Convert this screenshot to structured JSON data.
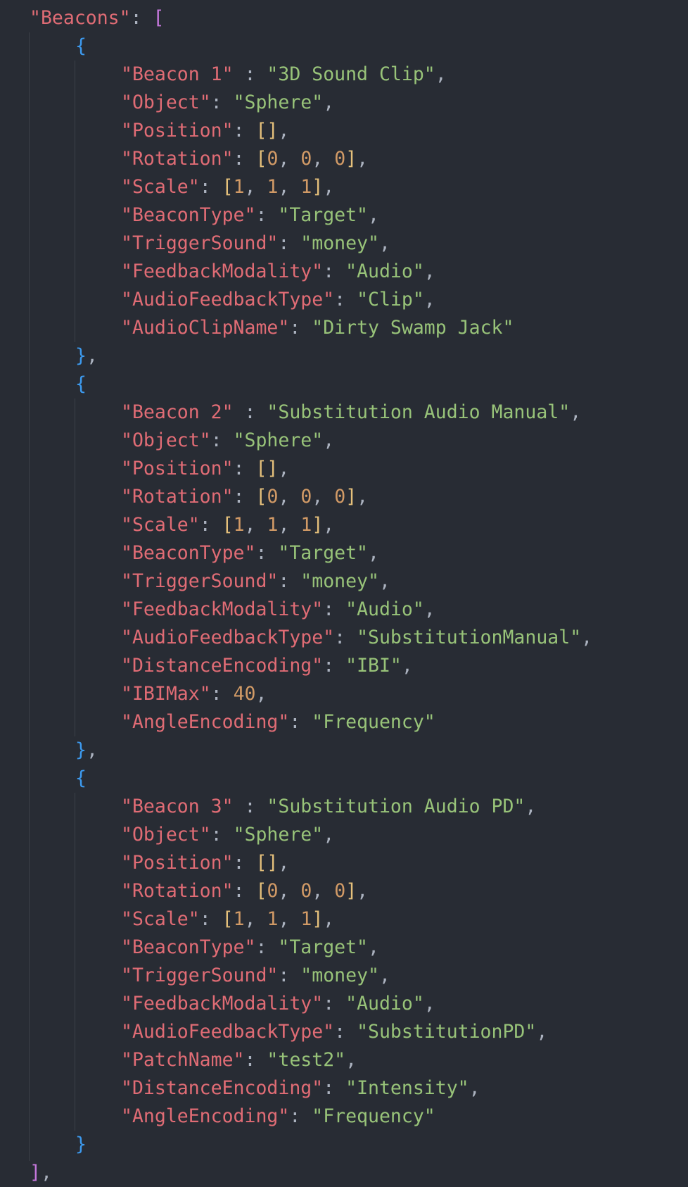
{
  "colors": {
    "background": "#282c34",
    "key": "#e06c75",
    "string": "#98c379",
    "number": "#d19a66",
    "punctuation": "#abb2bf",
    "bracket_level1": "#c678dd",
    "bracket_level2": "#3d9bf0",
    "bracket_level3": "#e5c07b"
  },
  "lines": [
    {
      "indent": 1,
      "tokens": [
        [
          "k",
          "\"Beacons\""
        ],
        [
          "p",
          ": "
        ],
        [
          "b1",
          "["
        ]
      ]
    },
    {
      "indent": 2,
      "tokens": [
        [
          "b2",
          "{"
        ]
      ]
    },
    {
      "indent": 3,
      "tokens": [
        [
          "k",
          "\"Beacon 1\""
        ],
        [
          "p",
          " : "
        ],
        [
          "s",
          "\"3D Sound Clip\""
        ],
        [
          "p",
          ","
        ]
      ]
    },
    {
      "indent": 3,
      "tokens": [
        [
          "k",
          "\"Object\""
        ],
        [
          "p",
          ": "
        ],
        [
          "s",
          "\"Sphere\""
        ],
        [
          "p",
          ","
        ]
      ]
    },
    {
      "indent": 3,
      "tokens": [
        [
          "k",
          "\"Position\""
        ],
        [
          "p",
          ": "
        ],
        [
          "b3",
          "[]"
        ],
        [
          "p",
          ","
        ]
      ]
    },
    {
      "indent": 3,
      "tokens": [
        [
          "k",
          "\"Rotation\""
        ],
        [
          "p",
          ": "
        ],
        [
          "b3",
          "["
        ],
        [
          "n",
          "0"
        ],
        [
          "p",
          ", "
        ],
        [
          "n",
          "0"
        ],
        [
          "p",
          ", "
        ],
        [
          "n",
          "0"
        ],
        [
          "b3",
          "]"
        ],
        [
          "p",
          ","
        ]
      ]
    },
    {
      "indent": 3,
      "tokens": [
        [
          "k",
          "\"Scale\""
        ],
        [
          "p",
          ": "
        ],
        [
          "b3",
          "["
        ],
        [
          "n",
          "1"
        ],
        [
          "p",
          ", "
        ],
        [
          "n",
          "1"
        ],
        [
          "p",
          ", "
        ],
        [
          "n",
          "1"
        ],
        [
          "b3",
          "]"
        ],
        [
          "p",
          ","
        ]
      ]
    },
    {
      "indent": 3,
      "tokens": [
        [
          "k",
          "\"BeaconType\""
        ],
        [
          "p",
          ": "
        ],
        [
          "s",
          "\"Target\""
        ],
        [
          "p",
          ","
        ]
      ]
    },
    {
      "indent": 3,
      "tokens": [
        [
          "k",
          "\"TriggerSound\""
        ],
        [
          "p",
          ": "
        ],
        [
          "s",
          "\"money\""
        ],
        [
          "p",
          ","
        ]
      ]
    },
    {
      "indent": 3,
      "tokens": [
        [
          "k",
          "\"FeedbackModality\""
        ],
        [
          "p",
          ": "
        ],
        [
          "s",
          "\"Audio\""
        ],
        [
          "p",
          ","
        ]
      ]
    },
    {
      "indent": 3,
      "tokens": [
        [
          "k",
          "\"AudioFeedbackType\""
        ],
        [
          "p",
          ": "
        ],
        [
          "s",
          "\"Clip\""
        ],
        [
          "p",
          ","
        ]
      ]
    },
    {
      "indent": 3,
      "tokens": [
        [
          "k",
          "\"AudioClipName\""
        ],
        [
          "p",
          ": "
        ],
        [
          "s",
          "\"Dirty Swamp Jack\""
        ]
      ]
    },
    {
      "indent": 2,
      "tokens": [
        [
          "b2",
          "}"
        ],
        [
          "p",
          ","
        ]
      ]
    },
    {
      "indent": 2,
      "tokens": [
        [
          "b2",
          "{"
        ]
      ]
    },
    {
      "indent": 3,
      "tokens": [
        [
          "k",
          "\"Beacon 2\""
        ],
        [
          "p",
          " : "
        ],
        [
          "s",
          "\"Substitution Audio Manual\""
        ],
        [
          "p",
          ","
        ]
      ]
    },
    {
      "indent": 3,
      "tokens": [
        [
          "k",
          "\"Object\""
        ],
        [
          "p",
          ": "
        ],
        [
          "s",
          "\"Sphere\""
        ],
        [
          "p",
          ","
        ]
      ]
    },
    {
      "indent": 3,
      "tokens": [
        [
          "k",
          "\"Position\""
        ],
        [
          "p",
          ": "
        ],
        [
          "b3",
          "[]"
        ],
        [
          "p",
          ","
        ]
      ]
    },
    {
      "indent": 3,
      "tokens": [
        [
          "k",
          "\"Rotation\""
        ],
        [
          "p",
          ": "
        ],
        [
          "b3",
          "["
        ],
        [
          "n",
          "0"
        ],
        [
          "p",
          ", "
        ],
        [
          "n",
          "0"
        ],
        [
          "p",
          ", "
        ],
        [
          "n",
          "0"
        ],
        [
          "b3",
          "]"
        ],
        [
          "p",
          ","
        ]
      ]
    },
    {
      "indent": 3,
      "tokens": [
        [
          "k",
          "\"Scale\""
        ],
        [
          "p",
          ": "
        ],
        [
          "b3",
          "["
        ],
        [
          "n",
          "1"
        ],
        [
          "p",
          ", "
        ],
        [
          "n",
          "1"
        ],
        [
          "p",
          ", "
        ],
        [
          "n",
          "1"
        ],
        [
          "b3",
          "]"
        ],
        [
          "p",
          ","
        ]
      ]
    },
    {
      "indent": 3,
      "tokens": [
        [
          "k",
          "\"BeaconType\""
        ],
        [
          "p",
          ": "
        ],
        [
          "s",
          "\"Target\""
        ],
        [
          "p",
          ","
        ]
      ]
    },
    {
      "indent": 3,
      "tokens": [
        [
          "k",
          "\"TriggerSound\""
        ],
        [
          "p",
          ": "
        ],
        [
          "s",
          "\"money\""
        ],
        [
          "p",
          ","
        ]
      ]
    },
    {
      "indent": 3,
      "tokens": [
        [
          "k",
          "\"FeedbackModality\""
        ],
        [
          "p",
          ": "
        ],
        [
          "s",
          "\"Audio\""
        ],
        [
          "p",
          ","
        ]
      ]
    },
    {
      "indent": 3,
      "tokens": [
        [
          "k",
          "\"AudioFeedbackType\""
        ],
        [
          "p",
          ": "
        ],
        [
          "s",
          "\"SubstitutionManual\""
        ],
        [
          "p",
          ","
        ]
      ]
    },
    {
      "indent": 3,
      "tokens": [
        [
          "k",
          "\"DistanceEncoding\""
        ],
        [
          "p",
          ": "
        ],
        [
          "s",
          "\"IBI\""
        ],
        [
          "p",
          ","
        ]
      ]
    },
    {
      "indent": 3,
      "tokens": [
        [
          "k",
          "\"IBIMax\""
        ],
        [
          "p",
          ": "
        ],
        [
          "n",
          "40"
        ],
        [
          "p",
          ","
        ]
      ]
    },
    {
      "indent": 3,
      "tokens": [
        [
          "k",
          "\"AngleEncoding\""
        ],
        [
          "p",
          ": "
        ],
        [
          "s",
          "\"Frequency\""
        ]
      ]
    },
    {
      "indent": 2,
      "tokens": [
        [
          "b2",
          "}"
        ],
        [
          "p",
          ","
        ]
      ]
    },
    {
      "indent": 2,
      "tokens": [
        [
          "b2",
          "{"
        ]
      ]
    },
    {
      "indent": 3,
      "tokens": [
        [
          "k",
          "\"Beacon 3\""
        ],
        [
          "p",
          " : "
        ],
        [
          "s",
          "\"Substitution Audio PD\""
        ],
        [
          "p",
          ","
        ]
      ]
    },
    {
      "indent": 3,
      "tokens": [
        [
          "k",
          "\"Object\""
        ],
        [
          "p",
          ": "
        ],
        [
          "s",
          "\"Sphere\""
        ],
        [
          "p",
          ","
        ]
      ]
    },
    {
      "indent": 3,
      "tokens": [
        [
          "k",
          "\"Position\""
        ],
        [
          "p",
          ": "
        ],
        [
          "b3",
          "[]"
        ],
        [
          "p",
          ","
        ]
      ]
    },
    {
      "indent": 3,
      "tokens": [
        [
          "k",
          "\"Rotation\""
        ],
        [
          "p",
          ": "
        ],
        [
          "b3",
          "["
        ],
        [
          "n",
          "0"
        ],
        [
          "p",
          ", "
        ],
        [
          "n",
          "0"
        ],
        [
          "p",
          ", "
        ],
        [
          "n",
          "0"
        ],
        [
          "b3",
          "]"
        ],
        [
          "p",
          ","
        ]
      ]
    },
    {
      "indent": 3,
      "tokens": [
        [
          "k",
          "\"Scale\""
        ],
        [
          "p",
          ": "
        ],
        [
          "b3",
          "["
        ],
        [
          "n",
          "1"
        ],
        [
          "p",
          ", "
        ],
        [
          "n",
          "1"
        ],
        [
          "p",
          ", "
        ],
        [
          "n",
          "1"
        ],
        [
          "b3",
          "]"
        ],
        [
          "p",
          ","
        ]
      ]
    },
    {
      "indent": 3,
      "tokens": [
        [
          "k",
          "\"BeaconType\""
        ],
        [
          "p",
          ": "
        ],
        [
          "s",
          "\"Target\""
        ],
        [
          "p",
          ","
        ]
      ]
    },
    {
      "indent": 3,
      "tokens": [
        [
          "k",
          "\"TriggerSound\""
        ],
        [
          "p",
          ": "
        ],
        [
          "s",
          "\"money\""
        ],
        [
          "p",
          ","
        ]
      ]
    },
    {
      "indent": 3,
      "tokens": [
        [
          "k",
          "\"FeedbackModality\""
        ],
        [
          "p",
          ": "
        ],
        [
          "s",
          "\"Audio\""
        ],
        [
          "p",
          ","
        ]
      ]
    },
    {
      "indent": 3,
      "tokens": [
        [
          "k",
          "\"AudioFeedbackType\""
        ],
        [
          "p",
          ": "
        ],
        [
          "s",
          "\"SubstitutionPD\""
        ],
        [
          "p",
          ","
        ]
      ]
    },
    {
      "indent": 3,
      "tokens": [
        [
          "k",
          "\"PatchName\""
        ],
        [
          "p",
          ": "
        ],
        [
          "s",
          "\"test2\""
        ],
        [
          "p",
          ","
        ]
      ]
    },
    {
      "indent": 3,
      "tokens": [
        [
          "k",
          "\"DistanceEncoding\""
        ],
        [
          "p",
          ": "
        ],
        [
          "s",
          "\"Intensity\""
        ],
        [
          "p",
          ","
        ]
      ]
    },
    {
      "indent": 3,
      "tokens": [
        [
          "k",
          "\"AngleEncoding\""
        ],
        [
          "p",
          ": "
        ],
        [
          "s",
          "\"Frequency\""
        ]
      ]
    },
    {
      "indent": 2,
      "tokens": [
        [
          "b2",
          "}"
        ]
      ]
    },
    {
      "indent": 1,
      "tokens": [
        [
          "b1",
          "]"
        ],
        [
          "p",
          ","
        ]
      ]
    }
  ]
}
